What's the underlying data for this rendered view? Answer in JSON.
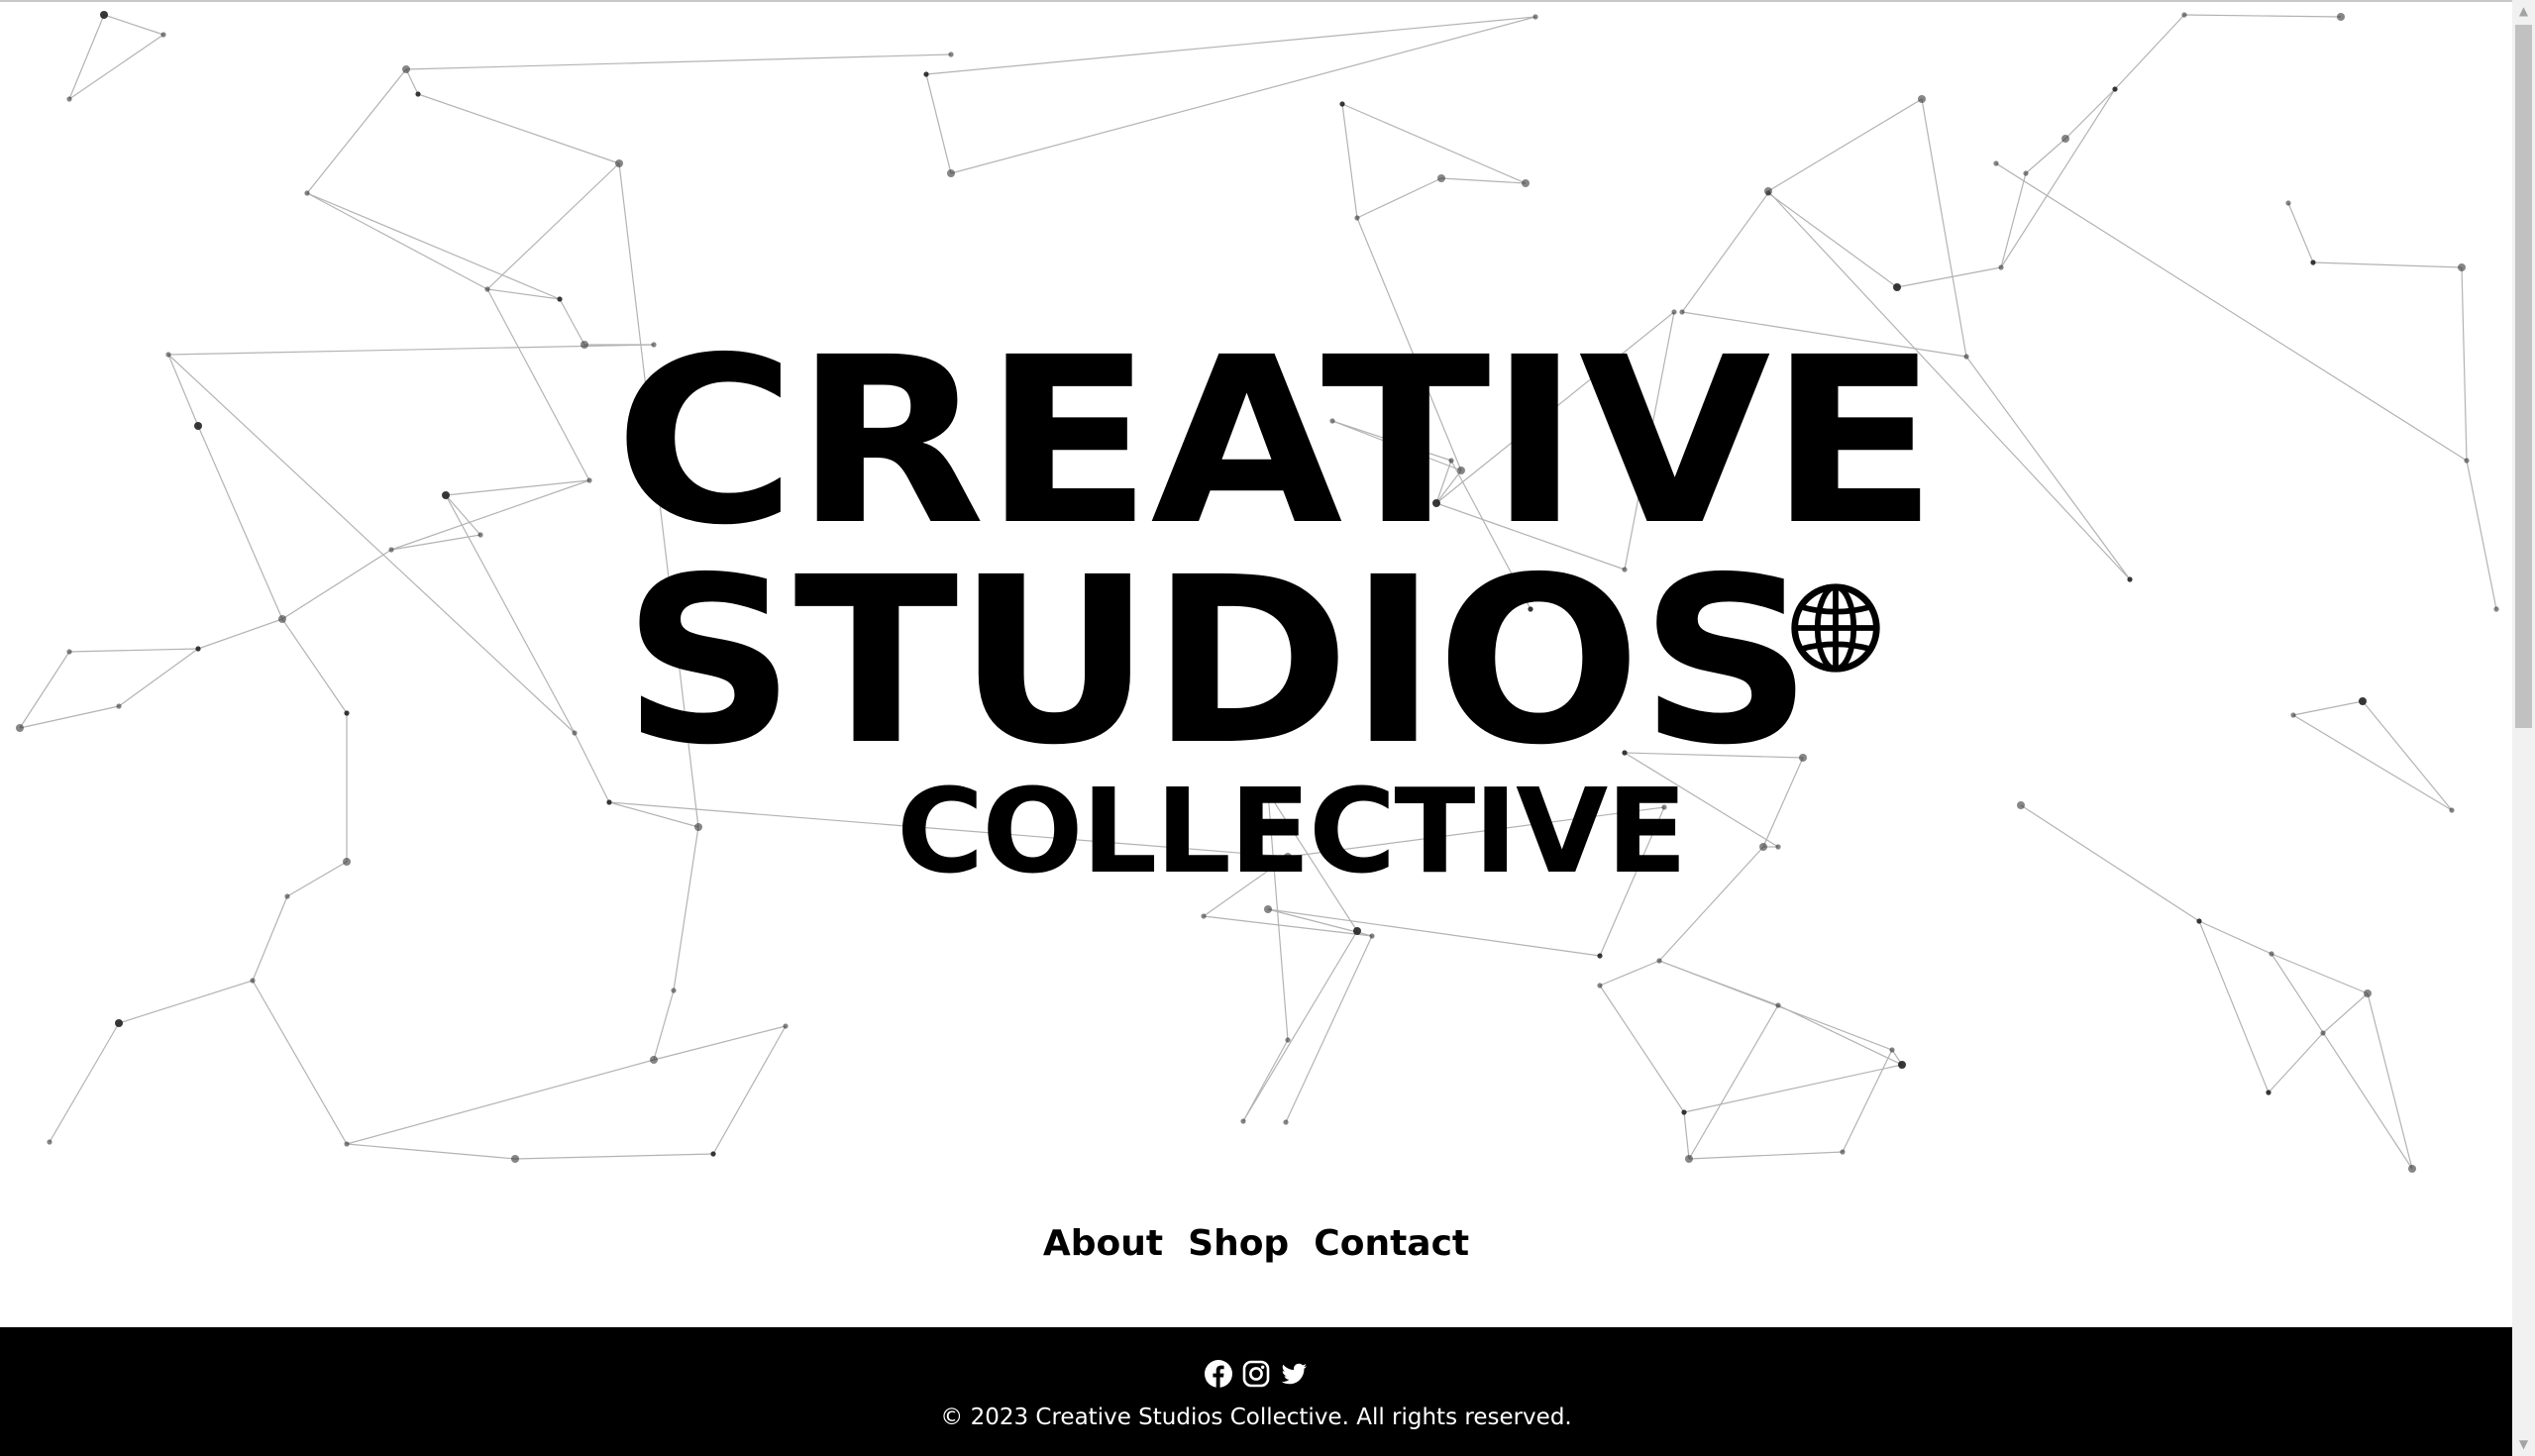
{
  "hero": {
    "line1": "CREATIVE",
    "line2": "STUDIOS",
    "line3": "COLLECTIVE",
    "icon": "globe-icon"
  },
  "nav": {
    "items": [
      {
        "label": "About"
      },
      {
        "label": "Shop"
      },
      {
        "label": "Contact"
      }
    ]
  },
  "footer": {
    "social": [
      "facebook-icon",
      "instagram-icon",
      "twitter-icon"
    ],
    "copyright": "© 2023 Creative Studios Collective. All rights reserved."
  },
  "colors": {
    "background": "#ffffff",
    "text": "#000000",
    "footer_background": "#000000",
    "footer_text": "#ffffff",
    "network_lines": "#b0b0b0"
  },
  "scrollbar": {
    "up_arrow": "▲",
    "down_arrow": "▼"
  }
}
